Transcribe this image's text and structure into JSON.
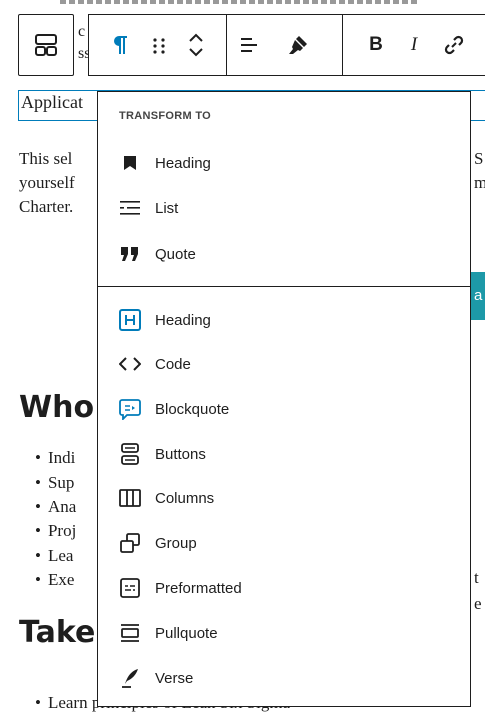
{
  "document": {
    "block_selected_text": "Applicat",
    "paragraph_left_lines": [
      "This sel",
      "yourself",
      "Charter."
    ],
    "paragraph_right_lines": [
      "S",
      "m"
    ],
    "button_partial": "a",
    "heading1": "Who",
    "bullets_left": [
      "Indi",
      "Sup",
      "Ana",
      "Proj",
      "Lea",
      "Exe"
    ],
    "bullets_right": [
      "t",
      "e"
    ],
    "heading2": "Take",
    "bottom_bullet": "Learn principles of Lean Six Sigma"
  },
  "toolbar": {
    "block_type_icon": "buttons-block-icon",
    "paragraph_icon": "paragraph-icon",
    "drag_icon": "drag-handle-icon",
    "move_icon": "move-up-down-icon",
    "align_icon": "align-left-icon",
    "highlight_icon": "highlighter-icon",
    "bold_label": "B",
    "italic_label": "I",
    "link_icon": "link-icon",
    "partial_text_a": "c",
    "partial_text_b": "ss"
  },
  "menu": {
    "title": "TRANSFORM TO",
    "items_top": [
      {
        "label": "Heading",
        "icon": "bookmark-icon"
      },
      {
        "label": "List",
        "icon": "list-icon"
      },
      {
        "label": "Quote",
        "icon": "quote-icon"
      }
    ],
    "items_bottom": [
      {
        "label": "Heading",
        "icon": "heading-h-icon"
      },
      {
        "label": "Code",
        "icon": "code-icon"
      },
      {
        "label": "Blockquote",
        "icon": "blockquote-icon"
      },
      {
        "label": "Buttons",
        "icon": "buttons-icon"
      },
      {
        "label": "Columns",
        "icon": "columns-icon"
      },
      {
        "label": "Group",
        "icon": "group-icon"
      },
      {
        "label": "Preformatted",
        "icon": "preformatted-icon"
      },
      {
        "label": "Pullquote",
        "icon": "pullquote-icon"
      },
      {
        "label": "Verse",
        "icon": "verse-icon"
      }
    ]
  },
  "colors": {
    "accent": "#007cba",
    "teal_button": "#1d99a8",
    "text": "#1e1e1e"
  }
}
